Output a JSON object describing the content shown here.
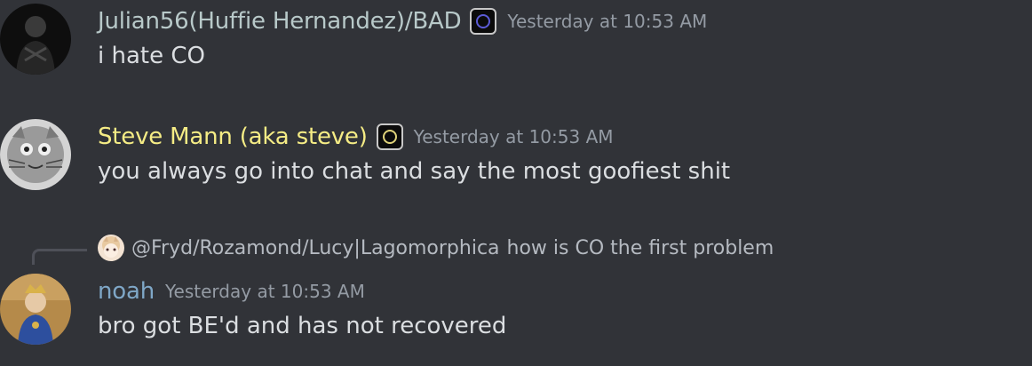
{
  "messages": [
    {
      "username": "Julian56(Huffie Hernandez)/BAD",
      "username_color": "#b8c9c9",
      "role_badge_color": "#5b5bd6",
      "timestamp": "Yesterday at 10:53 AM",
      "text": "i hate CO"
    },
    {
      "username": "Steve Mann (aka steve)",
      "username_color": "#f5ec85",
      "role_badge_color": "#e0d37a",
      "timestamp": "Yesterday at 10:53 AM",
      "text": "you always go into chat and say the most goofiest shit"
    },
    {
      "reply": {
        "mention": "@Fryd/Rozamond/Lucy|Lagomorphica",
        "text": "how is CO the first problem"
      },
      "username": "noah",
      "username_color": "#7fa7c7",
      "timestamp": "Yesterday at 10:53 AM",
      "text": "bro got BE'd and has not recovered"
    }
  ]
}
